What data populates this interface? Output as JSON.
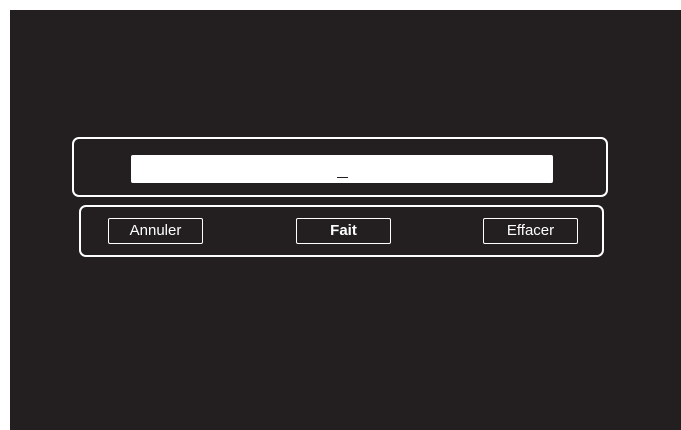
{
  "input": {
    "value": "",
    "cursor": "_"
  },
  "buttons": {
    "cancel_label": "Annuler",
    "done_label": "Fait",
    "clear_label": "Effacer"
  },
  "colors": {
    "background": "#231f20",
    "foreground": "#ffffff"
  }
}
